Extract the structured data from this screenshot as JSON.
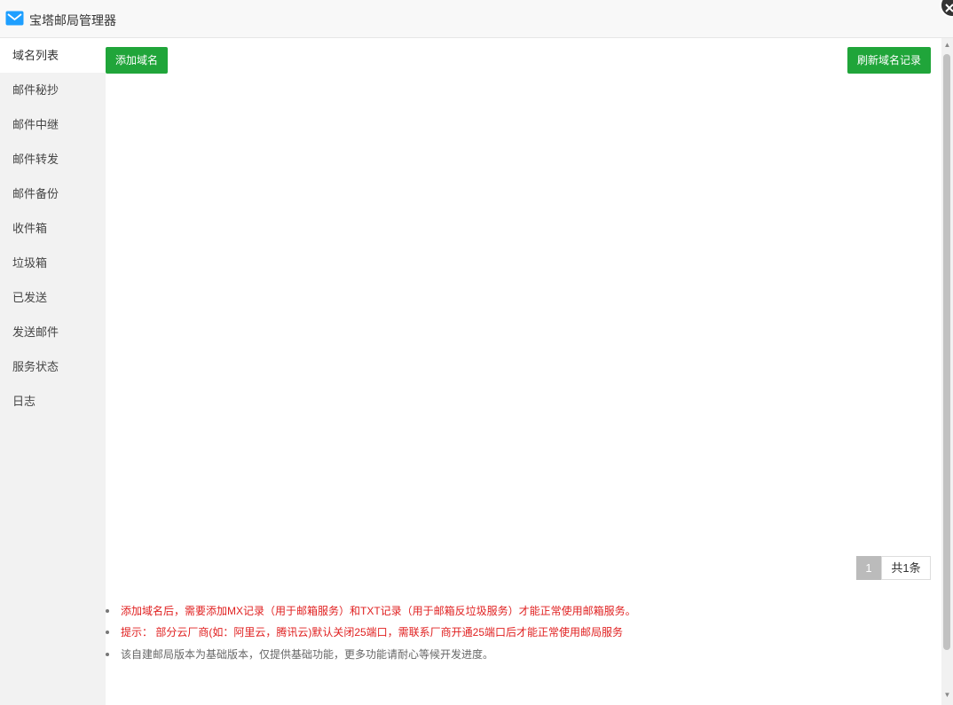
{
  "window": {
    "title": "宝塔邮局管理器"
  },
  "sidebar": {
    "items": [
      {
        "label": "域名列表"
      },
      {
        "label": "邮件秘抄"
      },
      {
        "label": "邮件中继"
      },
      {
        "label": "邮件转发"
      },
      {
        "label": "邮件备份"
      },
      {
        "label": "收件箱"
      },
      {
        "label": "垃圾箱"
      },
      {
        "label": "已发送"
      },
      {
        "label": "发送邮件"
      },
      {
        "label": "服务状态"
      },
      {
        "label": "日志"
      }
    ]
  },
  "toolbar": {
    "add_domain_label": "添加域名",
    "refresh_records_label": "刷新域名记录"
  },
  "pagination": {
    "current_page": "1",
    "total_label": "共1条"
  },
  "notes": [
    {
      "text": "添加域名后，需要添加MX记录（用于邮箱服务）和TXT记录（用于邮箱反垃圾服务）才能正常使用邮箱服务。"
    },
    {
      "text": "提示： 部分云厂商(如：阿里云，腾讯云)默认关闭25端口，需联系厂商开通25端口后才能正常使用邮局服务"
    },
    {
      "text": "该自建邮局版本为基础版本，仅提供基础功能，更多功能请耐心等候开发进度。"
    }
  ],
  "colors": {
    "accent": "#20a53a",
    "warning_text": "#e02020",
    "sidebar_bg": "#f2f2f2"
  }
}
